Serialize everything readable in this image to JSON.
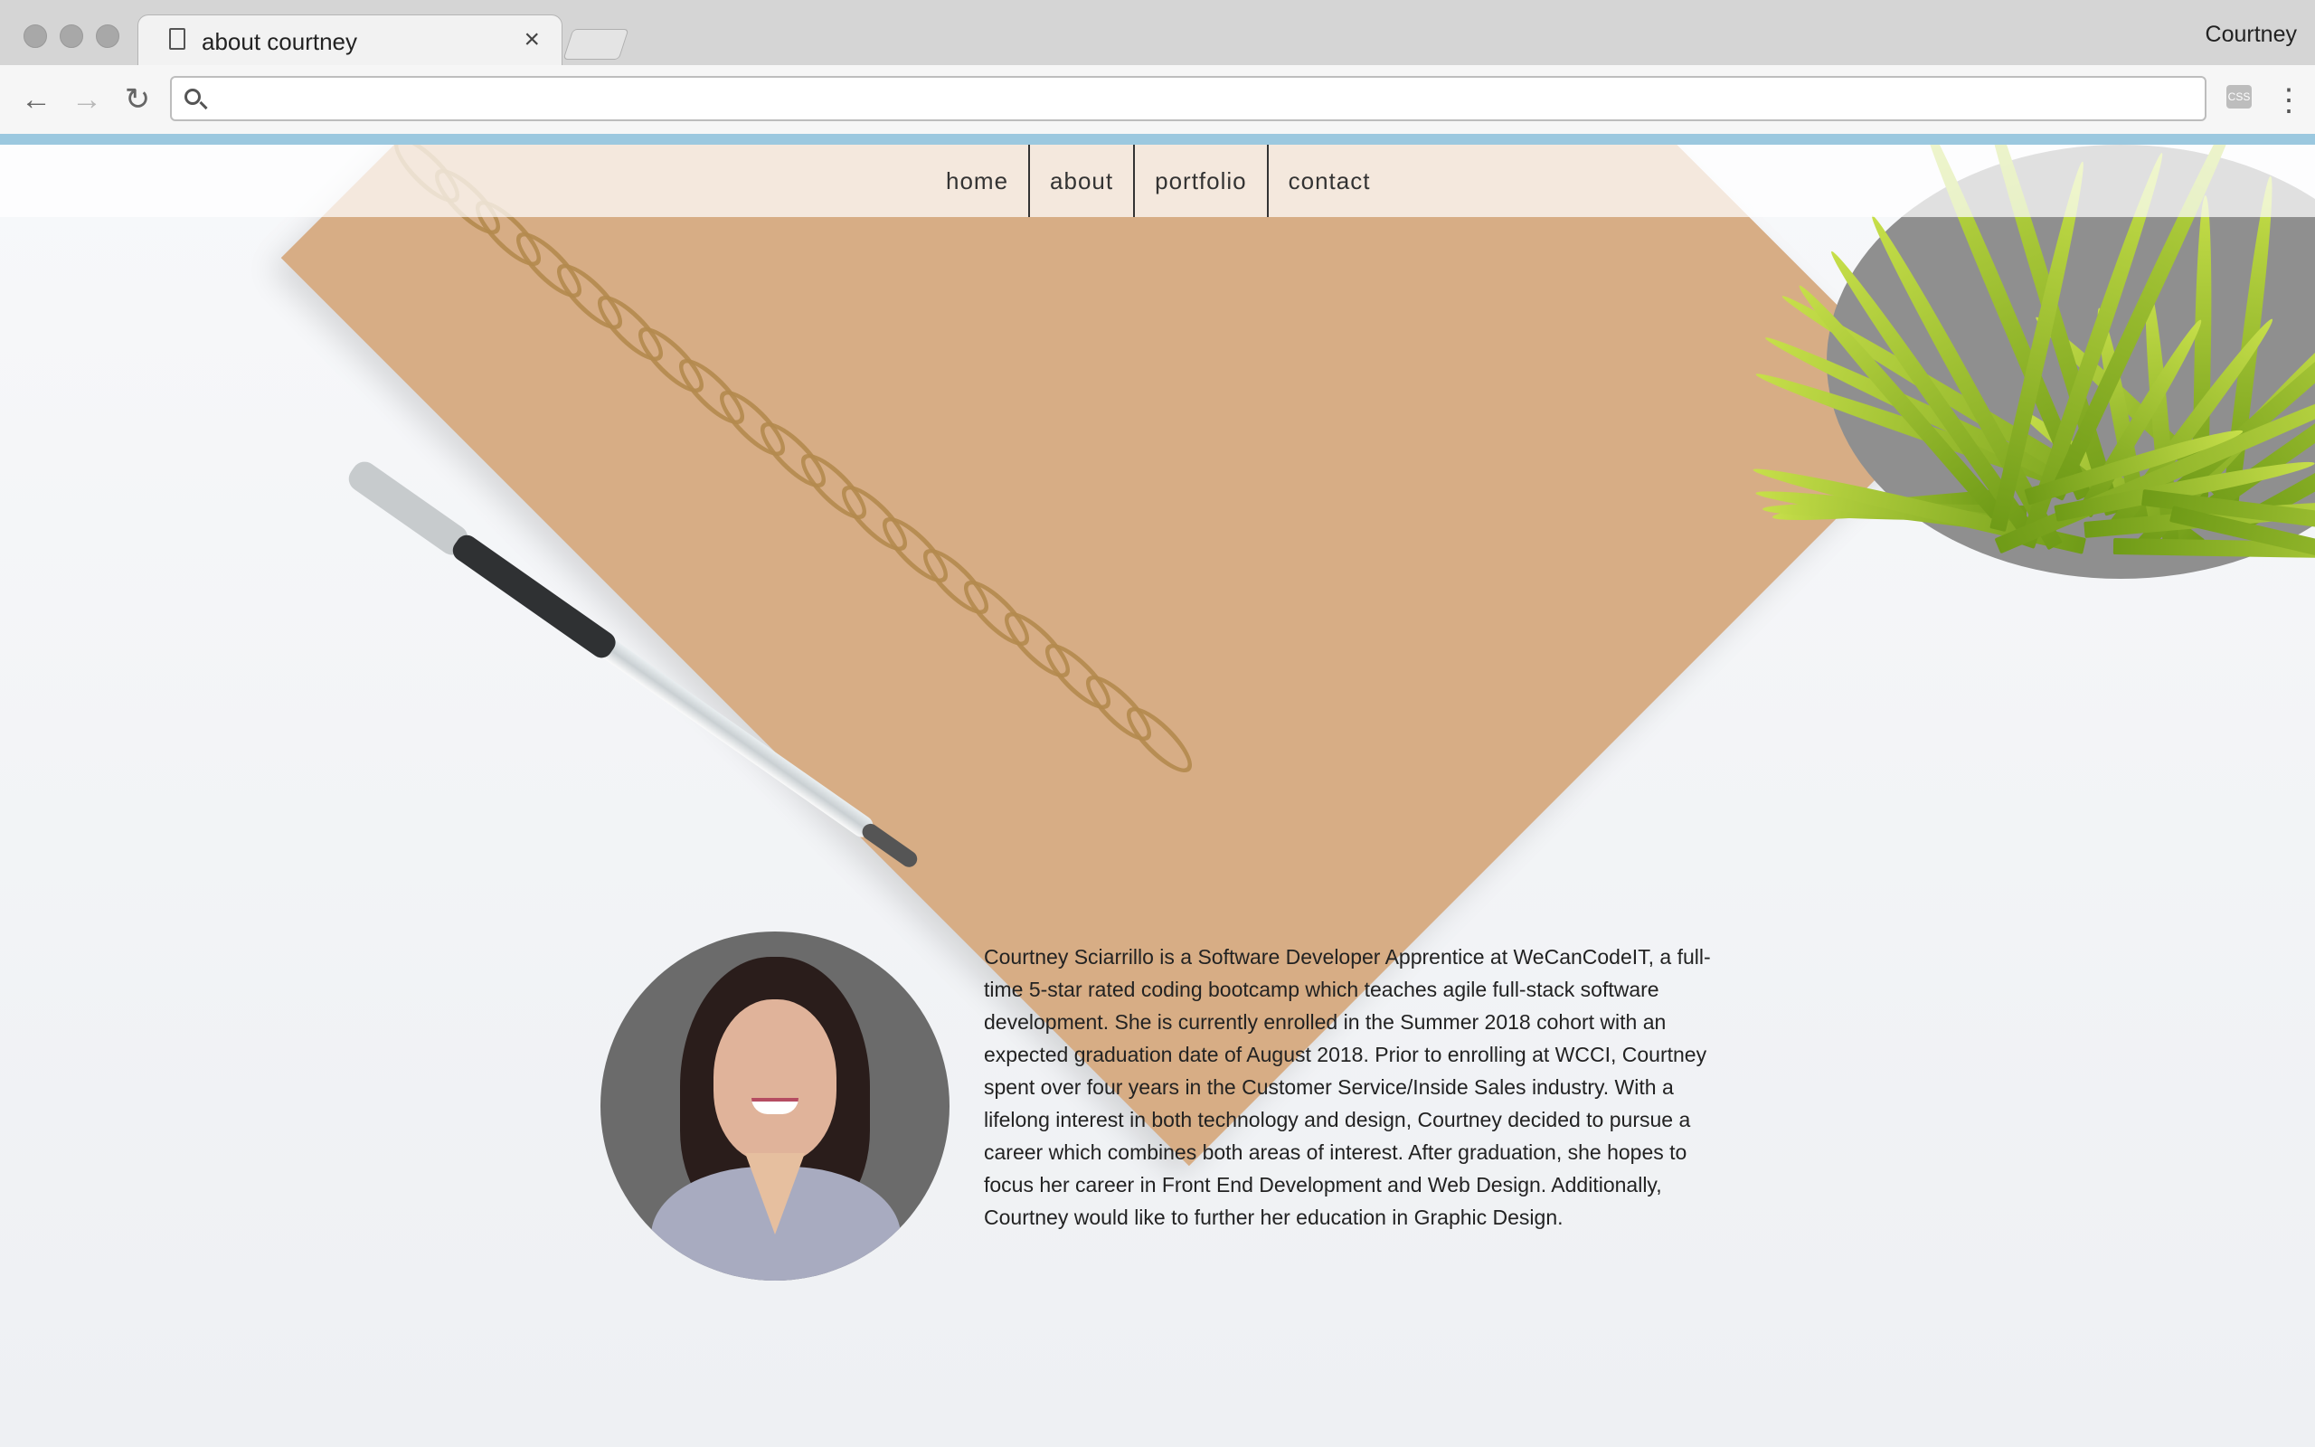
{
  "browser": {
    "tab_title": "about courtney",
    "profile_name": "Courtney",
    "address_value": "",
    "extension_label": "CSS"
  },
  "nav": {
    "items": [
      "home",
      "about",
      "portfolio",
      "contact"
    ]
  },
  "about": {
    "bio": "Courtney Sciarrillo is a Software Developer Apprentice at WeCanCodeIT, a full-time 5-star rated coding bootcamp which teaches agile full-stack software development. She is currently enrolled in the Summer 2018 cohort with an expected graduation date of August 2018. Prior to enrolling at WCCI, Courtney spent over four years in the Customer Service/Inside Sales industry. With a lifelong interest in both technology and design, Courtney decided to pursue a career which combines both areas of interest. After graduation, she hopes to focus her career in Front End Development and Web Design. Additionally, Courtney would like to further her education in Graphic Design."
  },
  "colors": {
    "accent": "#9bc8df",
    "notebook": "#d7ad85",
    "leaf": "#9cc21f"
  },
  "icons": {
    "back": "arrow-left-icon",
    "forward": "arrow-right-icon",
    "reload": "reload-icon",
    "search": "search-icon",
    "menu": "vertical-dots-icon"
  }
}
